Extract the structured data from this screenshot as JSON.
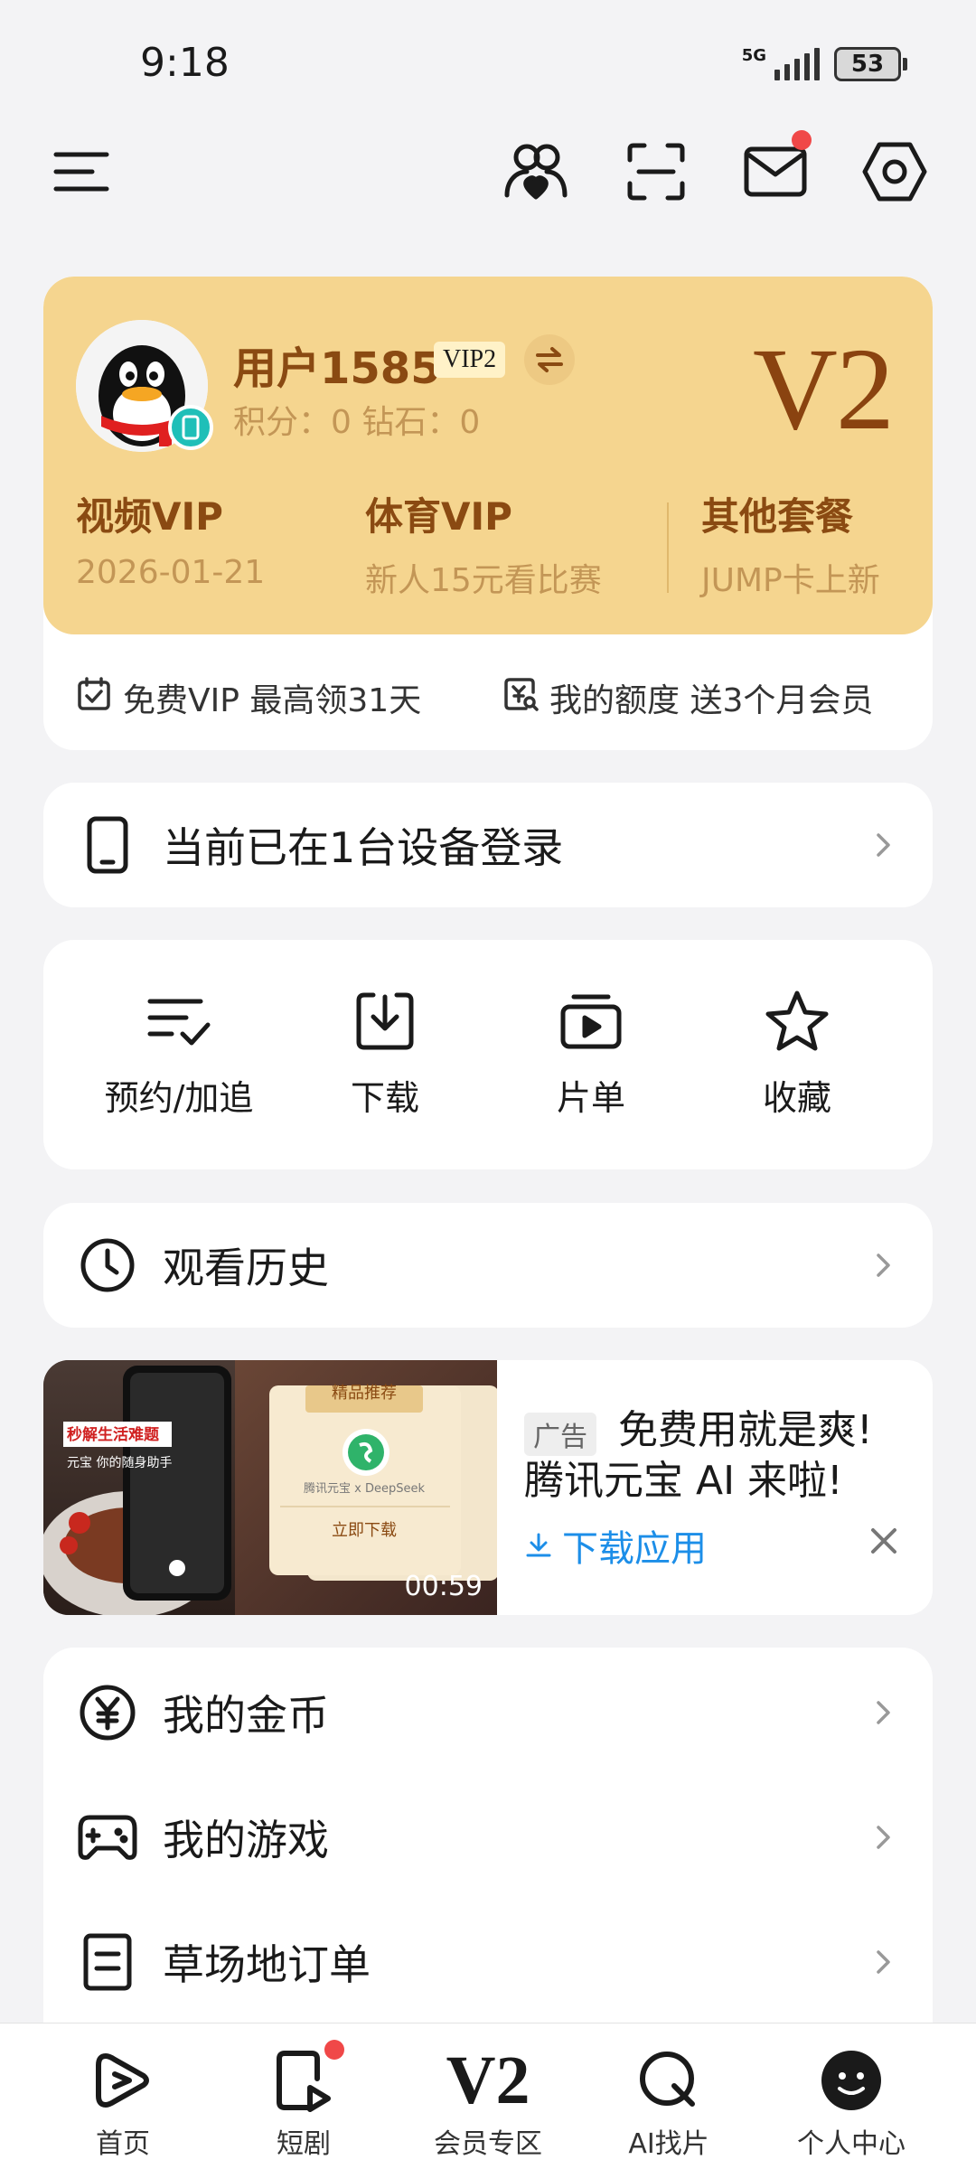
{
  "status_bar": {
    "time": "9:18",
    "network": "5G",
    "battery": "53"
  },
  "user": {
    "name": "用户1585",
    "vip_level_badge": "VIP2",
    "points_text": "积分：0    钻石：0",
    "level_display": "V2"
  },
  "vip_columns": [
    {
      "title": "视频VIP",
      "sub": "2026-01-21"
    },
    {
      "title": "体育VIP",
      "sub": "新人15元看比赛"
    },
    {
      "title": "其他套餐",
      "sub": "JUMP卡上新"
    }
  ],
  "vip_links": {
    "free_vip": "免费VIP 最高领31天",
    "quota": "我的额度 送3个月会员"
  },
  "devices_row": {
    "label": "当前已在1台设备登录"
  },
  "quick_actions": [
    {
      "label": "预约/加追",
      "icon": "list-check-icon"
    },
    {
      "label": "下载",
      "icon": "download-icon"
    },
    {
      "label": "片单",
      "icon": "playlist-icon"
    },
    {
      "label": "收藏",
      "icon": "star-icon"
    }
  ],
  "history_row": {
    "label": "观看历史"
  },
  "ad": {
    "tag": "广告",
    "title": "免费用就是爽! 腾讯元宝 AI 来啦!",
    "download_label": "下载应用",
    "duration": "00:59",
    "image_text_1": "秒解生活难题",
    "image_text_2": "元宝 你的随身助手",
    "image_text_3": "精品推荐",
    "image_text_4": "腾讯元宝 x DeepSeek",
    "image_text_5": "立即下载"
  },
  "menu_rows": [
    {
      "label": "我的金币",
      "icon": "yuan-coin-icon"
    },
    {
      "label": "我的游戏",
      "icon": "gamepad-icon"
    },
    {
      "label": "草场地订单",
      "icon": "order-doc-icon"
    }
  ],
  "bottom_nav": [
    {
      "label": "首页",
      "icon": "play-home-icon"
    },
    {
      "label": "短剧",
      "icon": "short-drama-icon"
    },
    {
      "label": "会员专区",
      "icon_text": "V2"
    },
    {
      "label": "AI找片",
      "icon": "ai-search-icon"
    },
    {
      "label": "个人中心",
      "icon": "profile-face-icon"
    }
  ],
  "colors": {
    "accent_gold": "#f5d58f",
    "brown": "#8a4a12",
    "link_blue": "#1c8ee8",
    "badge_red": "#f04848"
  }
}
